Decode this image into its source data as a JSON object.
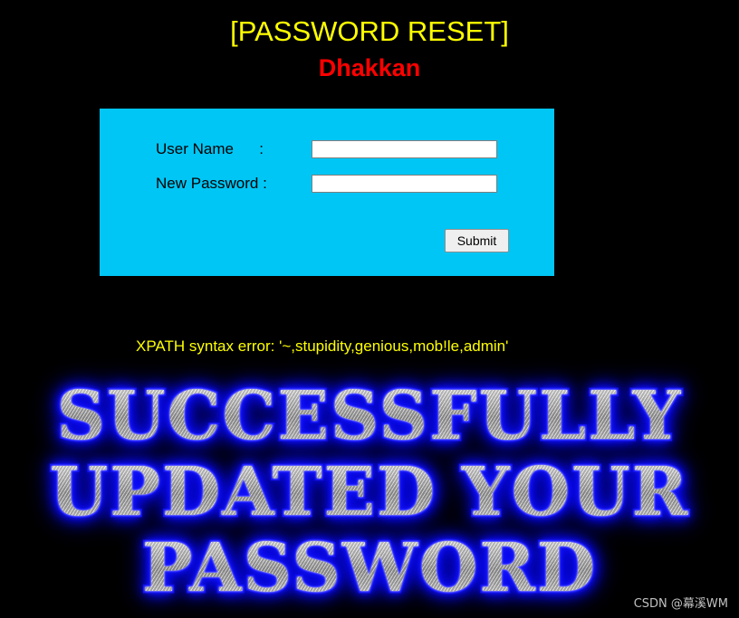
{
  "header": {
    "title": "[PASSWORD RESET]",
    "subtitle": "Dhakkan"
  },
  "form": {
    "panel_color": "#00c6f5",
    "username": {
      "label": "User Name      :",
      "value": "",
      "placeholder": ""
    },
    "password": {
      "label": "New Password :",
      "value": "",
      "placeholder": ""
    },
    "submit_label": "Submit"
  },
  "error": {
    "message": "XPATH syntax error: '~,stupidity,genious,mob!le,admin'",
    "color": "#ffff00"
  },
  "banner": {
    "line1": "SUCCESSFULLY",
    "line2": "UPDATED YOUR",
    "line3": "PASSWORD",
    "glow_color": "#1a1aff"
  },
  "watermark": {
    "text": "CSDN @幕溪WM"
  }
}
